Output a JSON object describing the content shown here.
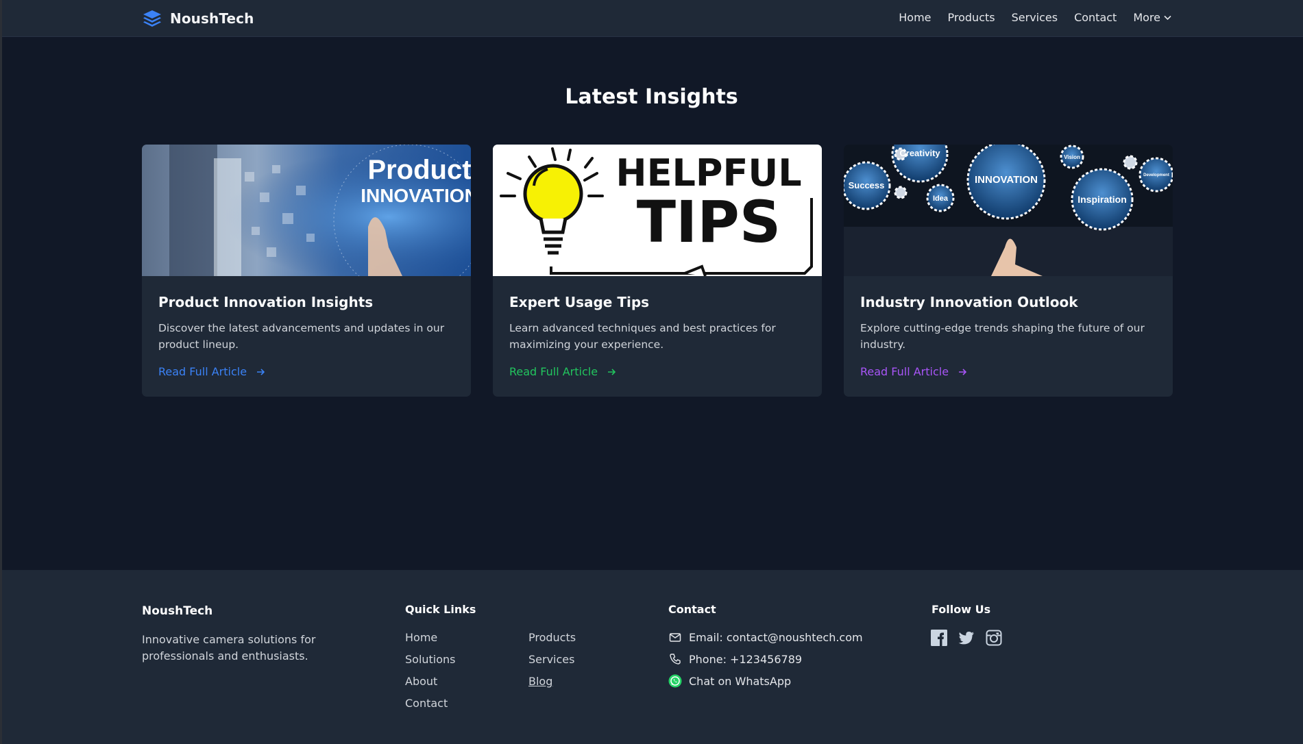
{
  "nav": {
    "brand": "NoushTech",
    "links": [
      "Home",
      "Products",
      "Services",
      "Contact"
    ],
    "more_label": "More"
  },
  "insights": {
    "title": "Latest Insights",
    "cards": [
      {
        "image_text": [
          "Product",
          "INNOVATION"
        ],
        "title": "Product Innovation Insights",
        "description": "Discover the latest advancements and updates in our product lineup.",
        "link": "Read Full Article",
        "accent": "#3b82f6"
      },
      {
        "image_text": [
          "HELPFUL",
          "TIPS"
        ],
        "title": "Expert Usage Tips",
        "description": "Learn advanced techniques and best practices for maximizing your experience.",
        "link": "Read Full Article",
        "accent": "#22c55e"
      },
      {
        "image_text": [
          "Creativity",
          "INNOVATION",
          "Success",
          "Idea",
          "Inspiration",
          "Vision",
          "Development"
        ],
        "title": "Industry Innovation Outlook",
        "description": "Explore cutting-edge trends shaping the future of our industry.",
        "link": "Read Full Article",
        "accent": "#a855f7"
      }
    ]
  },
  "footer": {
    "brand": "NoushTech",
    "tagline": "Innovative camera solutions for professionals and enthusiasts.",
    "quick_links_title": "Quick Links",
    "quick_links": [
      "Home",
      "Solutions",
      "About",
      "Contact",
      "Products",
      "Services",
      "Blog"
    ],
    "contact_title": "Contact",
    "contact": {
      "email": "Email: contact@noushtech.com",
      "phone": "Phone: +123456789",
      "whatsapp": "Chat on WhatsApp"
    },
    "follow_title": "Follow Us",
    "social": [
      "facebook-icon",
      "twitter-icon",
      "instagram-icon"
    ]
  },
  "colors": {
    "background": "#111827",
    "surface": "#1f2937",
    "brand_blue": "#3b82f6",
    "whatsapp_green": "#25d366"
  }
}
